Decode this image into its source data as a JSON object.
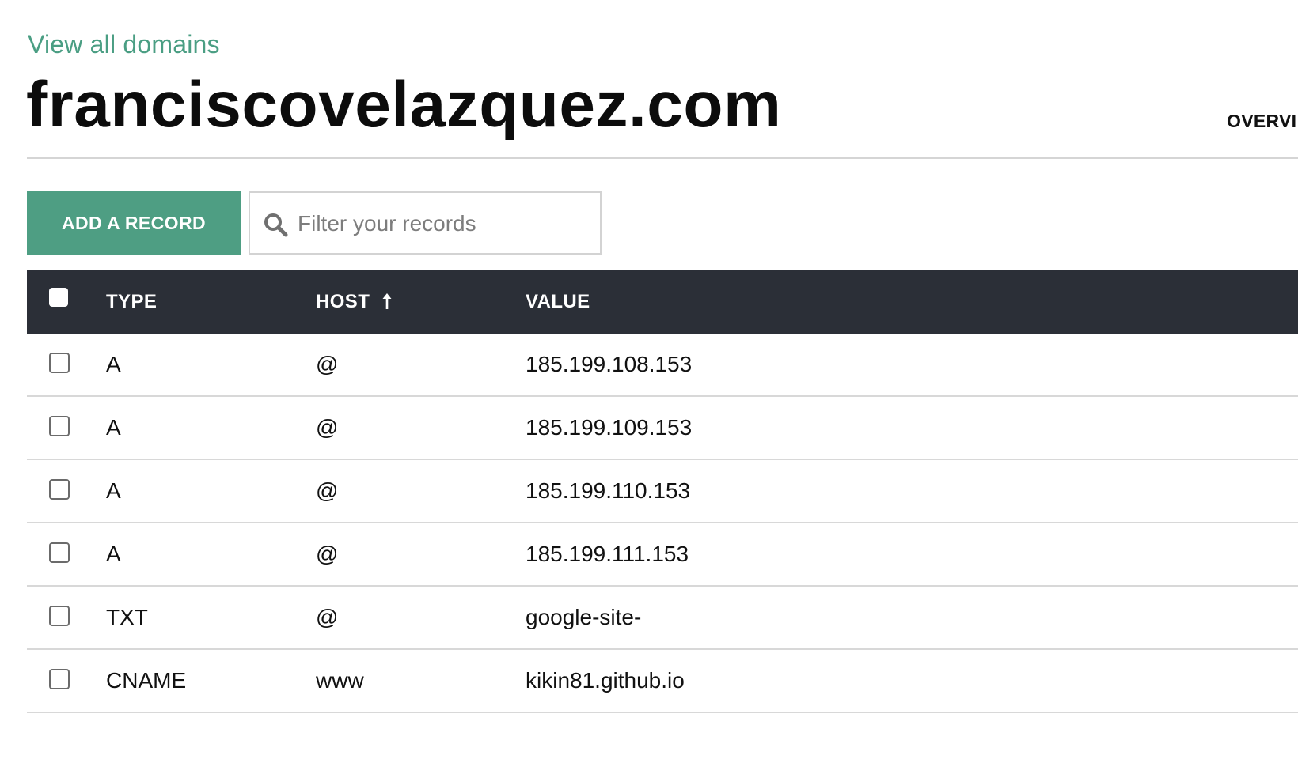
{
  "header": {
    "back_link": "View all domains",
    "domain": "franciscovelazquez.com",
    "nav_overview": "OVERVI"
  },
  "toolbar": {
    "add_button": "ADD A RECORD",
    "filter_placeholder": "Filter your records",
    "filter_value": ""
  },
  "table": {
    "columns": {
      "type": "TYPE",
      "host": "HOST",
      "value": "VALUE"
    },
    "sort": {
      "column": "host",
      "direction": "ascending",
      "icon": "arrow-up-icon"
    },
    "rows": [
      {
        "type": "A",
        "host": "@",
        "value": "185.199.108.153",
        "checked": false
      },
      {
        "type": "A",
        "host": "@",
        "value": "185.199.109.153",
        "checked": false
      },
      {
        "type": "A",
        "host": "@",
        "value": "185.199.110.153",
        "checked": false
      },
      {
        "type": "A",
        "host": "@",
        "value": "185.199.111.153",
        "checked": false
      },
      {
        "type": "TXT",
        "host": "@",
        "value": "google-site-",
        "checked": false
      },
      {
        "type": "CNAME",
        "host": "www",
        "value": "kikin81.github.io",
        "checked": false
      }
    ]
  },
  "colors": {
    "accent": "#4e9e83",
    "link": "#4a9e83",
    "table_header_bg": "#2b2f37",
    "divider": "#d8d8d8"
  }
}
